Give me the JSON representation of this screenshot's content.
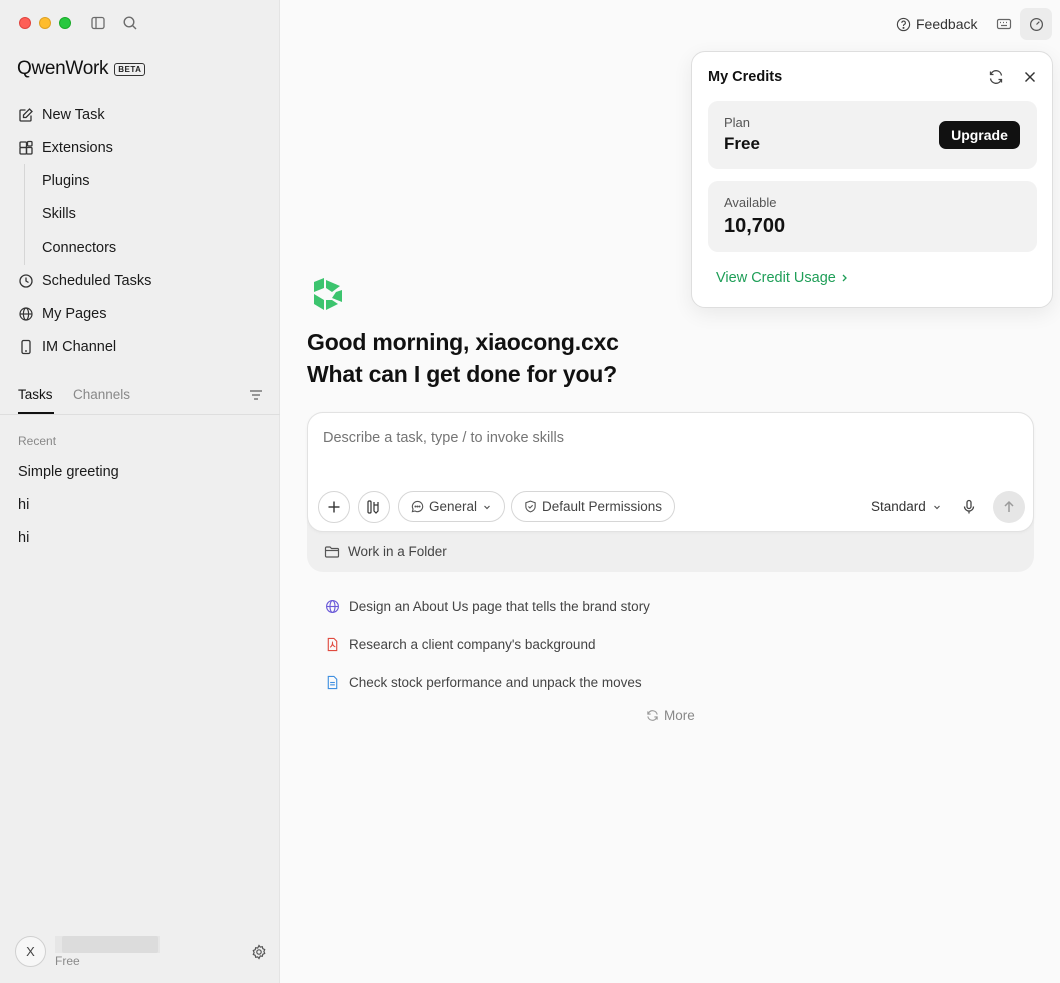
{
  "app": {
    "name": "QwenWork",
    "badge": "BETA"
  },
  "colors": {
    "accent_green": "#1e9e57",
    "logo_green": "#3cc46e",
    "upgrade_bg": "#111111"
  },
  "sidebar": {
    "nav": [
      {
        "label": "New Task",
        "icon": "edit-icon"
      },
      {
        "label": "Extensions",
        "icon": "extensions-icon"
      }
    ],
    "sub_nav": [
      "Plugins",
      "Skills",
      "Connectors"
    ],
    "nav_bottom": [
      {
        "label": "Scheduled Tasks",
        "icon": "clock-icon"
      },
      {
        "label": "My Pages",
        "icon": "globe-icon"
      },
      {
        "label": "IM Channel",
        "icon": "phone-icon"
      }
    ],
    "tabs": [
      "Tasks",
      "Channels"
    ],
    "recent_label": "Recent",
    "tasks": [
      "Simple greeting",
      "hi",
      "hi"
    ],
    "user": {
      "initial": "X",
      "plan": "Free"
    }
  },
  "topbar": {
    "feedback_label": "Feedback"
  },
  "main": {
    "greeting_line1": "Good morning, xiaocong.cxc",
    "greeting_line2": "What can I get done for you?",
    "composer": {
      "placeholder": "Describe a task, type / to invoke skills",
      "mode_label": "General",
      "permissions_label": "Default Permissions",
      "model_label": "Standard",
      "folder_label": "Work in a Folder"
    },
    "suggestions": [
      {
        "text": "Design an About Us page that tells the brand story",
        "icon": "globe-icon"
      },
      {
        "text": "Research a client company's background",
        "icon": "pdf-icon"
      },
      {
        "text": "Check stock performance and unpack the moves",
        "icon": "document-icon"
      }
    ],
    "more_label": "More"
  },
  "credits_popover": {
    "title": "My Credits",
    "plan_label": "Plan",
    "plan_value": "Free",
    "upgrade_label": "Upgrade",
    "available_label": "Available",
    "available_value": "10,700",
    "usage_link": "View Credit Usage"
  }
}
